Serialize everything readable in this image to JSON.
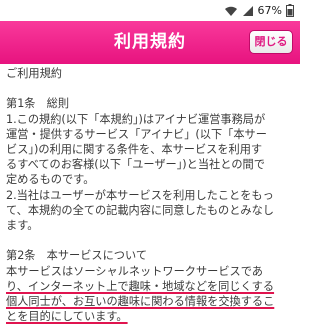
{
  "status": {
    "battery_text": "67%",
    "icons": [
      "wifi-icon",
      "signal-icon",
      "battery-icon"
    ]
  },
  "header": {
    "title": "利用規約",
    "close_label": "閉じる"
  },
  "content": {
    "heading": "ご利用規約",
    "article1_title": "第1条　総則",
    "article1_lines": [
      "1.この規約(以下「本規約」)はアイナビ運営事務局が",
      "運営・提供するサービス「アイナビ」(以下「本サー",
      "ビス」)の利用に関する条件を、本サービスを利用す",
      "るすべてのお客様(以下「ユーザー」)と当社との間で",
      "定めるものです。",
      "2.当社はユーザーが本サービスを利用したことをもっ",
      "て、本規約の全ての記載内容に同意したものとみなし",
      "ます。"
    ],
    "article2_title": "第2条　本サービスについて",
    "article2_lines": [
      "本サービスはソーシャルネットワークサービスであ",
      "り、インターネット上で趣味・地域などを同じくする",
      "個人同士が、お互いの趣味に関わる情報を交換するこ",
      "とを目的にしています。"
    ]
  },
  "colors": {
    "header_pink": "#f12a8e",
    "underline_red": "#e0144f"
  }
}
